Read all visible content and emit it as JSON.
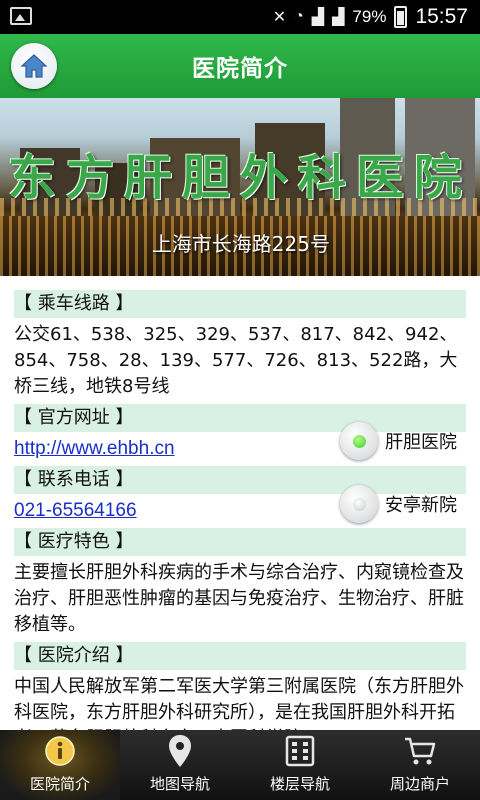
{
  "status_bar": {
    "battery": "79%",
    "time": "15:57"
  },
  "header": {
    "title": "医院简介"
  },
  "banner": {
    "title": "东方肝胆外科医院",
    "address": "上海市长海路225号"
  },
  "sections": [
    {
      "heading": "【 乘车线路 】",
      "body": "公交61、538、325、329、537、817、842、942、854、758、28、139、577、726、813、522路，大桥三线，地铁8号线"
    },
    {
      "heading": "【 官方网址 】",
      "link": "http://www.ehbh.cn"
    },
    {
      "heading": "【 联系电话 】",
      "link": "021-65564166"
    },
    {
      "heading": "【 医疗特色 】",
      "body": "主要擅长肝胆外科疾病的手术与综合治疗、内窥镜检查及治疗、肝胆恶性肿瘤的基因与免疫治疗、生物治疗、肝脏移植等。"
    },
    {
      "heading": "【 医院介绍 】",
      "body": "中国人民解放军第二军医大学第三附属医院（东方肝胆外科医院，东方肝胆外科研究所），是在我国肝胆外科开拓者、著名肝胆外科专家、中国科学院"
    }
  ],
  "campus_selector": {
    "options": [
      {
        "label": "肝胆医院",
        "selected": true
      },
      {
        "label": "安亭新院",
        "selected": false
      }
    ]
  },
  "tabs": [
    {
      "label": "医院简介",
      "icon": "info-icon",
      "active": true
    },
    {
      "label": "地图导航",
      "icon": "map-pin-icon",
      "active": false
    },
    {
      "label": "楼层导航",
      "icon": "building-icon",
      "active": false
    },
    {
      "label": "周边商户",
      "icon": "shopping-cart-icon",
      "active": false
    }
  ],
  "colors": {
    "header_green": "#2aae44",
    "section_bg": "#d8f1e4",
    "link_blue": "#1a2ec8",
    "radio_selected": "#3ec83a"
  }
}
